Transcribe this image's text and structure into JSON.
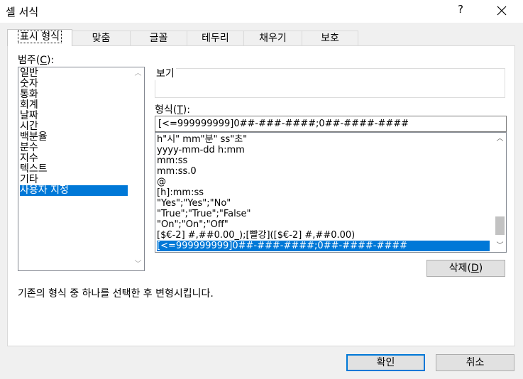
{
  "window": {
    "title": "셀 서식",
    "help": "?",
    "close": "✕"
  },
  "tabs": [
    {
      "label": "표시 형식"
    },
    {
      "label": "맞춤"
    },
    {
      "label": "글꼴"
    },
    {
      "label": "테두리"
    },
    {
      "label": "채우기"
    },
    {
      "label": "보호"
    }
  ],
  "category": {
    "label_pre": "범주(",
    "label_key": "C",
    "label_post": "):",
    "items": [
      "일반",
      "숫자",
      "통화",
      "회계",
      "날짜",
      "시간",
      "백분율",
      "분수",
      "지수",
      "텍스트",
      "기타",
      "사용자 지정"
    ],
    "selected_index": 11
  },
  "preview": {
    "label": "보기",
    "value": ""
  },
  "format": {
    "label_pre": "형식(",
    "label_key": "T",
    "label_post": "):",
    "value": "[<=999999999]0##-###-####;0##-####-####",
    "items": [
      "h\"시\" mm\"분\" ss\"초\"",
      "yyyy-mm-dd h:mm",
      "mm:ss",
      "mm:ss.0",
      "@",
      "[h]:mm:ss",
      "\"Yes\";\"Yes\";\"No\"",
      "\"True\";\"True\";\"False\"",
      "\"On\";\"On\";\"Off\"",
      "[$€-2] #,##0.00_);[빨강]([$€-2] #,##0.00)",
      "[<=999999999]0##-###-####;0##-####-####"
    ],
    "selected_index": 10,
    "scroll_position": 0.93
  },
  "delete_button": {
    "pre": "삭제(",
    "key": "D",
    "post": ")"
  },
  "description": "기존의 형식 중 하나를 선택한 후 변형시킵니다.",
  "ok_button": "확인",
  "cancel_button": "취소",
  "colors": {
    "selection": "#0078d7",
    "dialog_bg": "#f0f0f0"
  }
}
